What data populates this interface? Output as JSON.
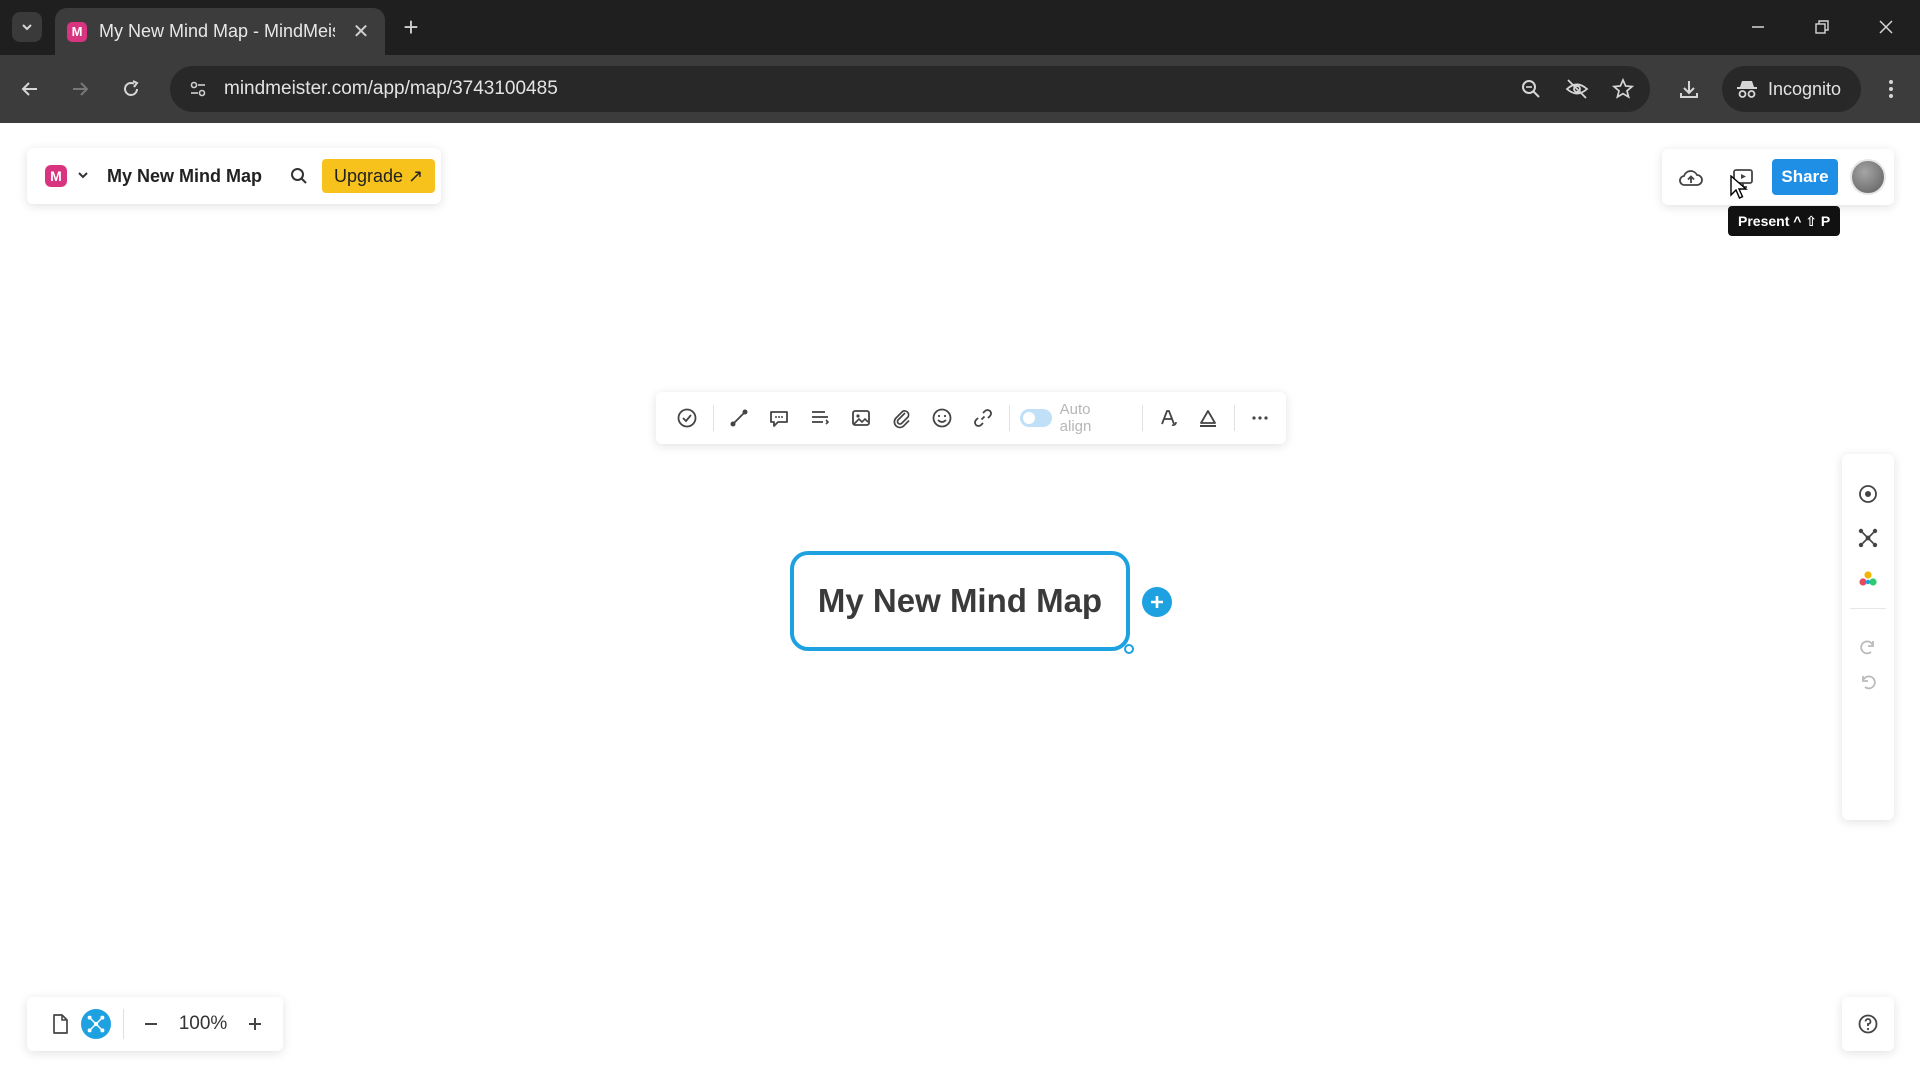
{
  "browser": {
    "tab_title": "My New Mind Map - MindMeister",
    "favicon_letter": "M",
    "url": "mindmeister.com/app/map/3743100485",
    "incognito_label": "Incognito"
  },
  "app": {
    "logo_letter": "M",
    "doc_title": "My New Mind Map",
    "upgrade_label": "Upgrade ↗",
    "share_label": "Share",
    "tooltip": "Present ^ ⇧ P",
    "node_toolbar": {
      "auto_align_label": "Auto align"
    },
    "root_node": {
      "text": "My New Mind Map"
    },
    "zoom": {
      "level": "100%"
    }
  },
  "colors": {
    "accent": "#1ea1e0",
    "share": "#1f8fe6",
    "upgrade": "#f7c21b",
    "brand": "#d8347f"
  },
  "icons": {
    "node_toolbar": [
      "check-circle-icon",
      "connection-icon",
      "comment-icon",
      "note-icon",
      "image-icon",
      "attachment-icon",
      "emoji-icon",
      "link-icon",
      "style-icon",
      "text-color-icon",
      "more-icon"
    ],
    "right_panel": [
      "focus-icon",
      "mind-map-layout-icon",
      "theme-icon",
      "redo-icon",
      "undo-icon"
    ]
  }
}
